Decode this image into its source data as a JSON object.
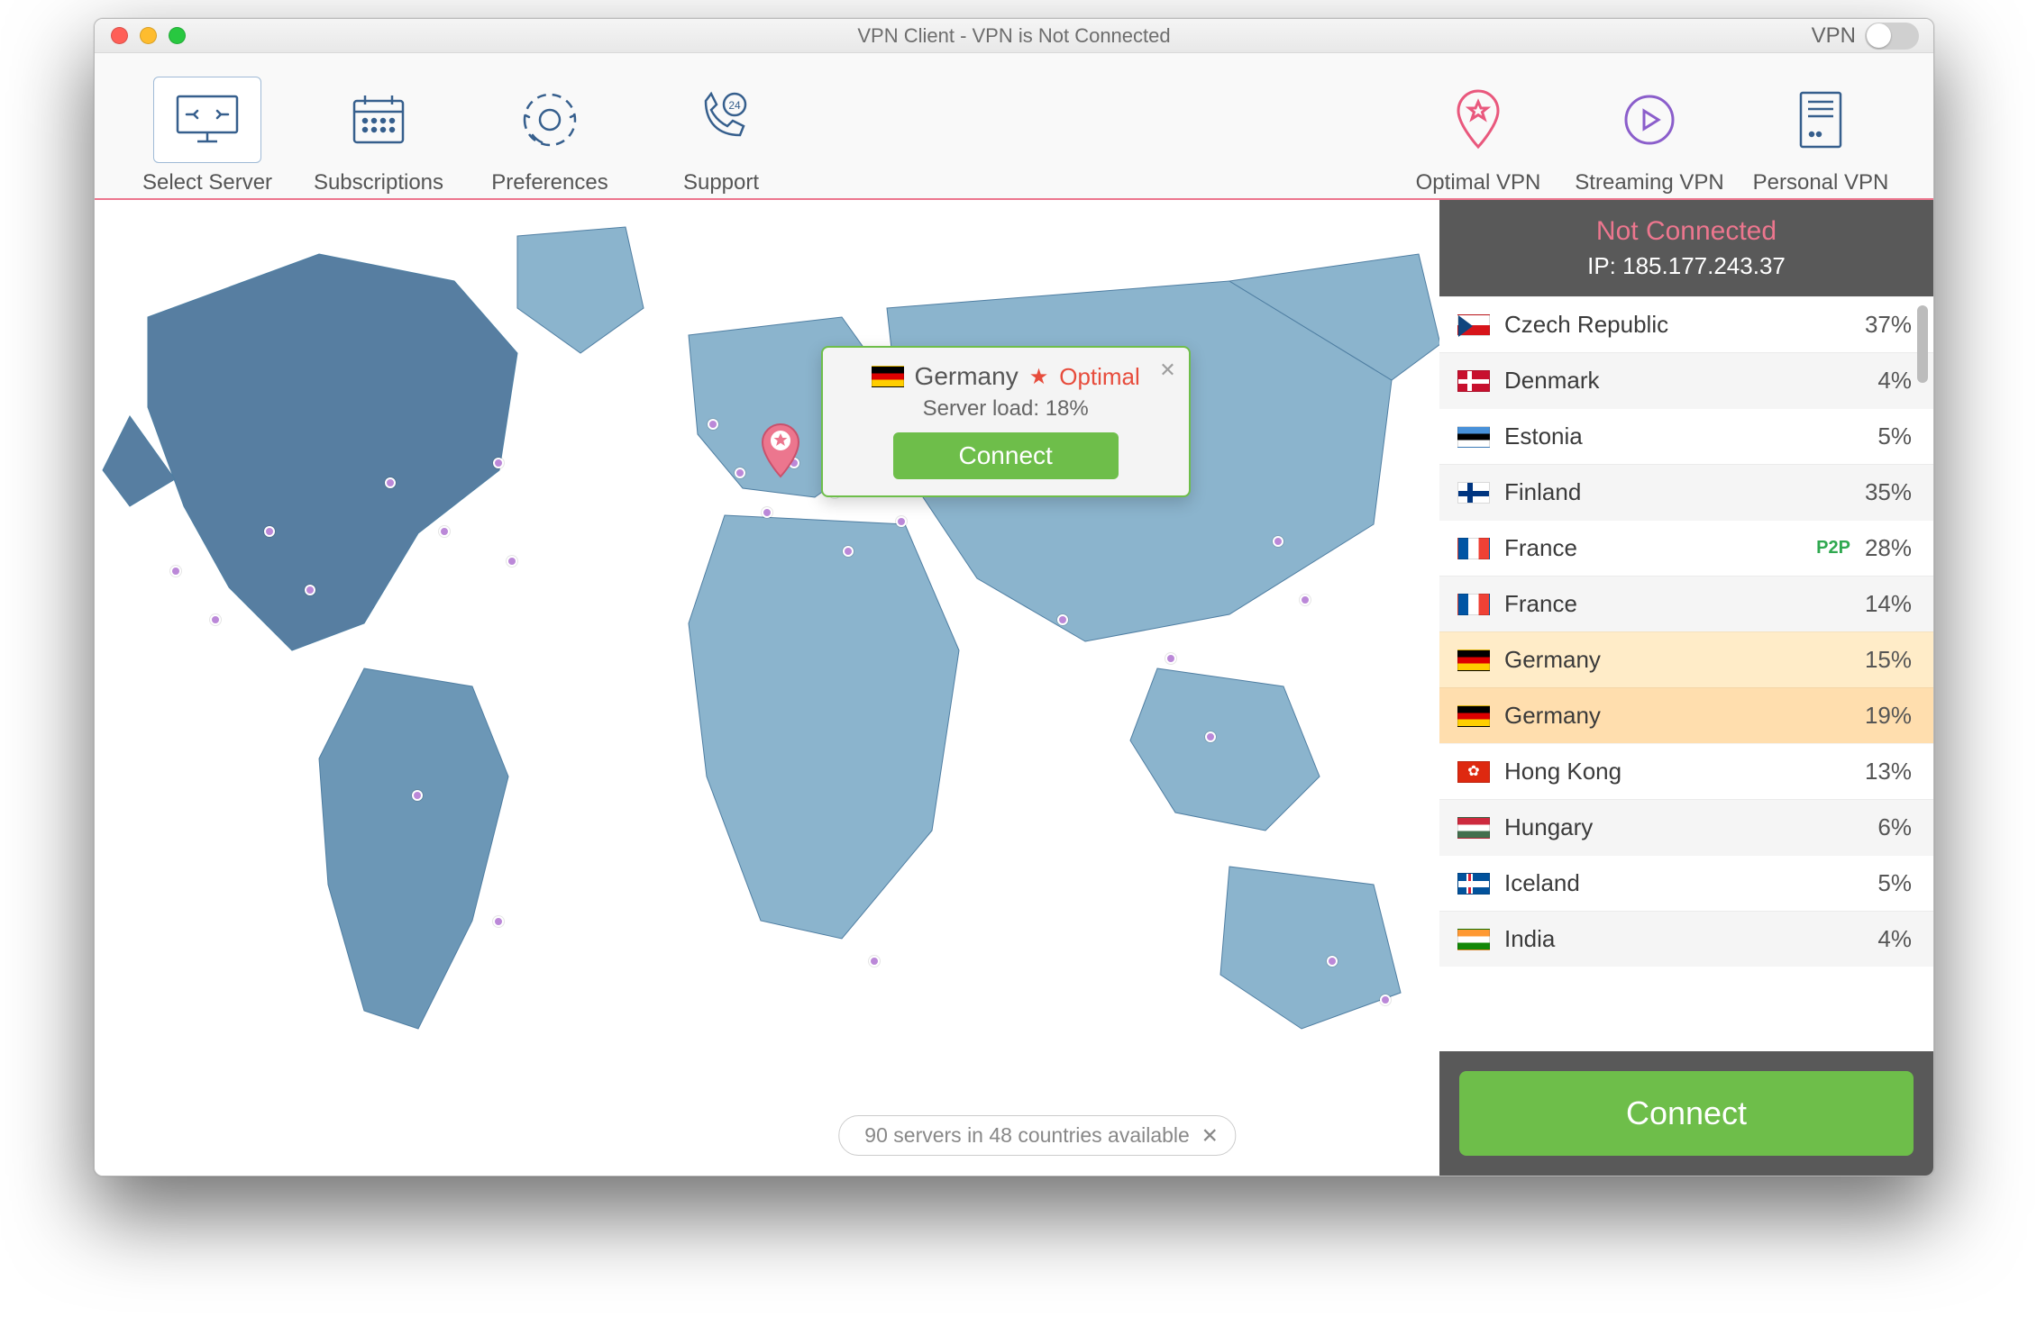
{
  "titlebar": {
    "title": "VPN Client - VPN is Not Connected",
    "switch_label": "VPN"
  },
  "toolbar": {
    "left": [
      {
        "id": "select-server",
        "label": "Select Server",
        "selected": true
      },
      {
        "id": "subscriptions",
        "label": "Subscriptions"
      },
      {
        "id": "preferences",
        "label": "Preferences"
      },
      {
        "id": "support",
        "label": "Support"
      }
    ],
    "right": [
      {
        "id": "optimal-vpn",
        "label": "Optimal VPN"
      },
      {
        "id": "streaming-vpn",
        "label": "Streaming VPN"
      },
      {
        "id": "personal-vpn",
        "label": "Personal VPN"
      }
    ]
  },
  "map": {
    "tooltip": {
      "country": "Germany",
      "optimal_label": "Optimal",
      "server_load_label": "Server load:",
      "server_load_value": "18%",
      "connect_label": "Connect"
    },
    "status_pill": "90 servers in 48 countries available"
  },
  "sidebar": {
    "status": "Not Connected",
    "ip_label": "IP:",
    "ip_value": "185.177.243.37",
    "connect_label": "Connect",
    "servers": [
      {
        "flag": "cz",
        "name": "Czech Republic",
        "tag": "",
        "load": "37%",
        "variant": ""
      },
      {
        "flag": "dk",
        "name": "Denmark",
        "tag": "",
        "load": "4%",
        "variant": "alt"
      },
      {
        "flag": "ee",
        "name": "Estonia",
        "tag": "",
        "load": "5%",
        "variant": ""
      },
      {
        "flag": "fi",
        "name": "Finland",
        "tag": "",
        "load": "35%",
        "variant": "alt"
      },
      {
        "flag": "fr",
        "name": "France",
        "tag": "P2P",
        "load": "28%",
        "variant": ""
      },
      {
        "flag": "fr",
        "name": "France",
        "tag": "",
        "load": "14%",
        "variant": "alt"
      },
      {
        "flag": "de",
        "name": "Germany",
        "tag": "",
        "load": "15%",
        "variant": "sel1"
      },
      {
        "flag": "de",
        "name": "Germany",
        "tag": "",
        "load": "19%",
        "variant": "sel2"
      },
      {
        "flag": "hk",
        "name": "Hong Kong",
        "tag": "",
        "load": "13%",
        "variant": ""
      },
      {
        "flag": "hu",
        "name": "Hungary",
        "tag": "",
        "load": "6%",
        "variant": "alt"
      },
      {
        "flag": "is",
        "name": "Iceland",
        "tag": "",
        "load": "5%",
        "variant": ""
      },
      {
        "flag": "in",
        "name": "India",
        "tag": "",
        "load": "4%",
        "variant": "alt"
      }
    ]
  }
}
